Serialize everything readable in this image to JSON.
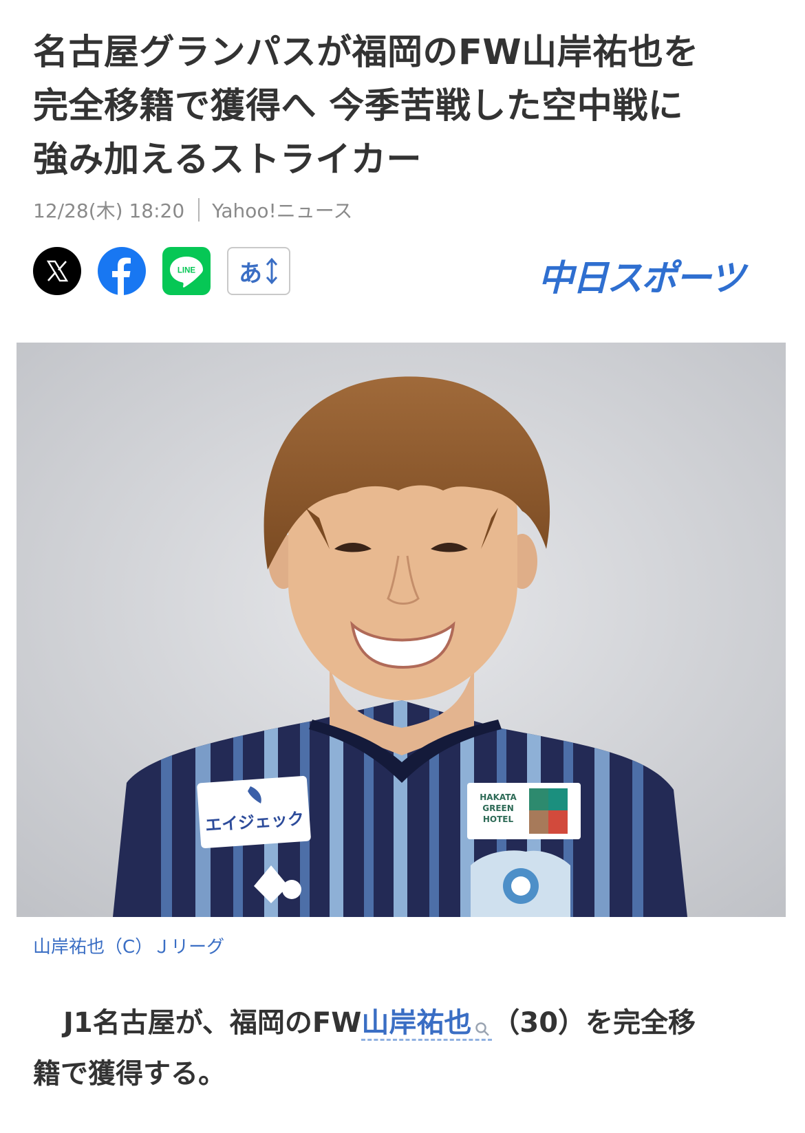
{
  "article": {
    "title_line1": "名古屋グランパスが福岡のFW山岸祐也を",
    "title_line2": "完全移籍で獲得へ 今季苦戦した空中戦に",
    "title_line3": "強み加えるストライカー",
    "date": "12/28(木) 18:20",
    "source": "Yahoo!ニュース"
  },
  "share": {
    "x_label": "X",
    "facebook_label": "f",
    "line_label": "LINE",
    "font_size_label": "あ",
    "font_size_arrow": "↕"
  },
  "brand": {
    "name": "中日スポーツ",
    "color": "#2f6fd0"
  },
  "photo": {
    "sponsor_left": "エイジェック",
    "sponsor_right_line1": "HAKATA",
    "sponsor_right_line2": "GREEN",
    "sponsor_right_line3": "HOTEL",
    "caption": "山岸祐也（C）Ｊリーグ"
  },
  "body": {
    "part1": "J1名古屋が、福岡のFW",
    "keyword": "山岸祐也",
    "part2": "（30）を完全移",
    "line2": "籍で獲得する。"
  },
  "colors": {
    "link": "#3a6ec4",
    "x_bg": "#000000",
    "facebook_bg": "#1877f2",
    "line_bg": "#06c755"
  }
}
